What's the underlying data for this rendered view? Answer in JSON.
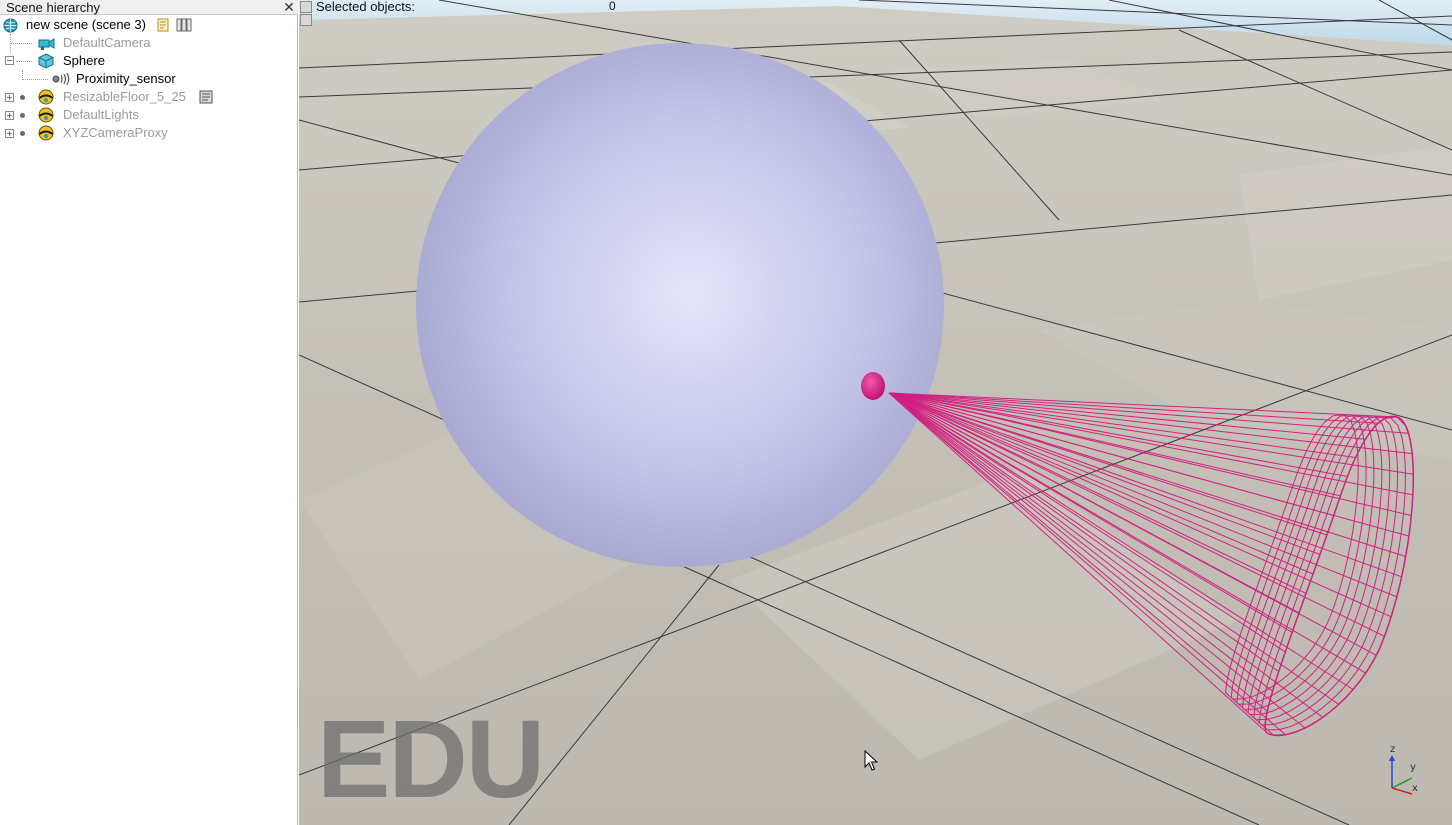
{
  "hierarchy": {
    "title": "Scene hierarchy",
    "items": [
      {
        "label": "new scene (scene 3)"
      },
      {
        "label": "DefaultCamera"
      },
      {
        "label": "Sphere"
      },
      {
        "label": "Proximity_sensor"
      },
      {
        "label": "ResizableFloor_5_25"
      },
      {
        "label": "DefaultLights"
      },
      {
        "label": "XYZCameraProxy"
      }
    ]
  },
  "viewport": {
    "selected_label": "Selected objects:",
    "selected_count": "0",
    "watermark": "EDU",
    "axes": {
      "z": "z",
      "y": "y",
      "x": "x"
    }
  },
  "colors": {
    "sphere": "#c7c8ec",
    "sensor": "#d4107a",
    "floor": "#c9c6bd",
    "sky": "#cfe3f0"
  }
}
